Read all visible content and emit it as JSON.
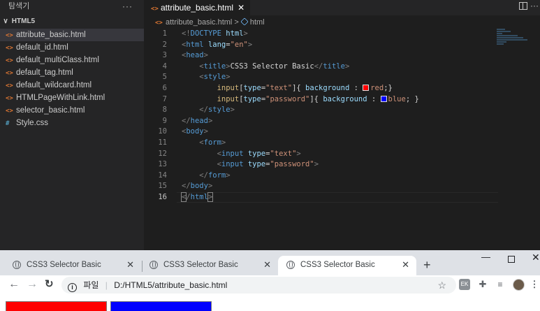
{
  "explorer": {
    "title": "탐색기",
    "more": "···",
    "folder": "HTML5",
    "files": [
      {
        "name": "attribute_basic.html",
        "icon": "html-icon",
        "active": true
      },
      {
        "name": "default_id.html",
        "icon": "html-icon"
      },
      {
        "name": "default_multiClass.html",
        "icon": "html-icon"
      },
      {
        "name": "default_tag.html",
        "icon": "html-icon"
      },
      {
        "name": "default_wildcard.html",
        "icon": "html-icon"
      },
      {
        "name": "HTMLPageWithLink.html",
        "icon": "html-icon"
      },
      {
        "name": "selector_basic.html",
        "icon": "html-icon"
      },
      {
        "name": "Style.css",
        "icon": "css-icon"
      }
    ]
  },
  "editor": {
    "tab_label": "attribute_basic.html",
    "breadcrumb_file": "attribute_basic.html",
    "breadcrumb_symbol": "html",
    "current_line": 16,
    "lines": [
      "<!DOCTYPE html>",
      "<html lang=\"en\">",
      "<head>",
      "    <title>CSS3 Selector Basic</title>",
      "    <style>",
      "        input[type=\"text\"]{ background : red;}",
      "        input[type=\"password\"]{ background : blue; }",
      "    </style>",
      "</head>",
      "<body>",
      "    <form>",
      "        <input type=\"text\">",
      "        <input type=\"password\">",
      "    </form>",
      "</body>",
      "</html>"
    ]
  },
  "browser": {
    "tabs": [
      {
        "title": "CSS3 Selector Basic",
        "selected": false
      },
      {
        "title": "CSS3 Selector Basic",
        "selected": false
      },
      {
        "title": "CSS3 Selector Basic",
        "selected": true
      }
    ],
    "address_prefix": "파일",
    "address": "D:/HTML5/attribute_basic.html",
    "page_inputs": [
      {
        "type": "text",
        "color": "#ff0000"
      },
      {
        "type": "password",
        "color": "#0000ff"
      }
    ]
  },
  "colors": {
    "red": "#ff0000",
    "blue": "#0000ff"
  }
}
